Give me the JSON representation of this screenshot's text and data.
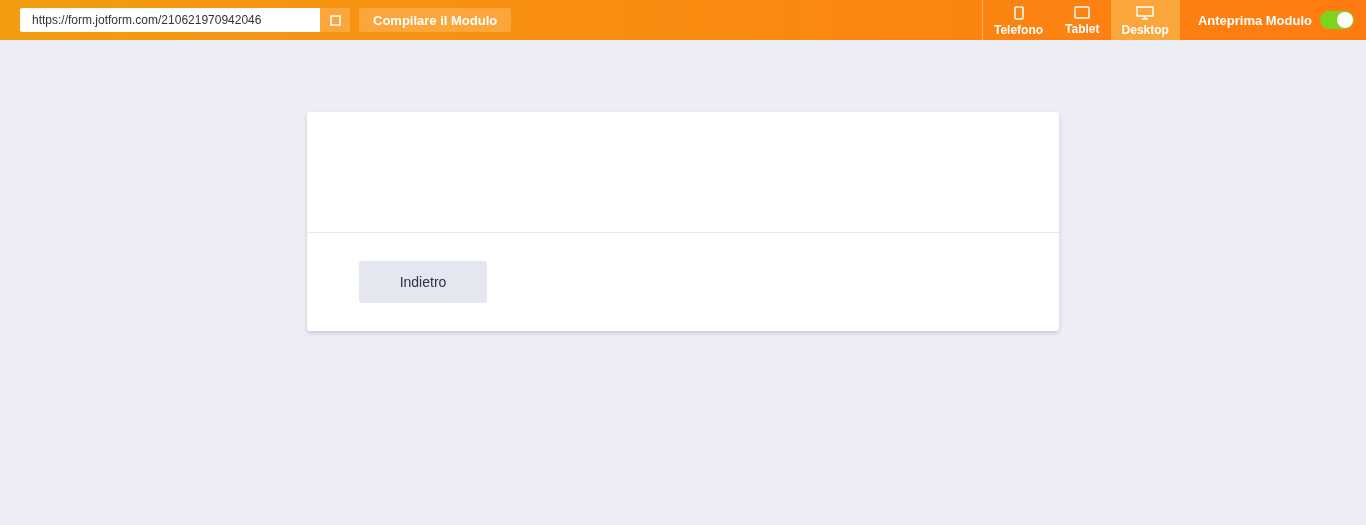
{
  "toolbar": {
    "url": "https://form.jotform.com/210621970942046",
    "compile_button": "Compilare il Modulo",
    "devices": [
      {
        "label": "Telefono",
        "kind": "phone",
        "selected": false
      },
      {
        "label": "Tablet",
        "kind": "tablet",
        "selected": false
      },
      {
        "label": "Desktop",
        "kind": "desktop",
        "selected": true
      }
    ],
    "preview_toggle": {
      "label": "Anteprima Modulo",
      "on": true
    }
  },
  "form": {
    "back_button": "Indietro"
  }
}
